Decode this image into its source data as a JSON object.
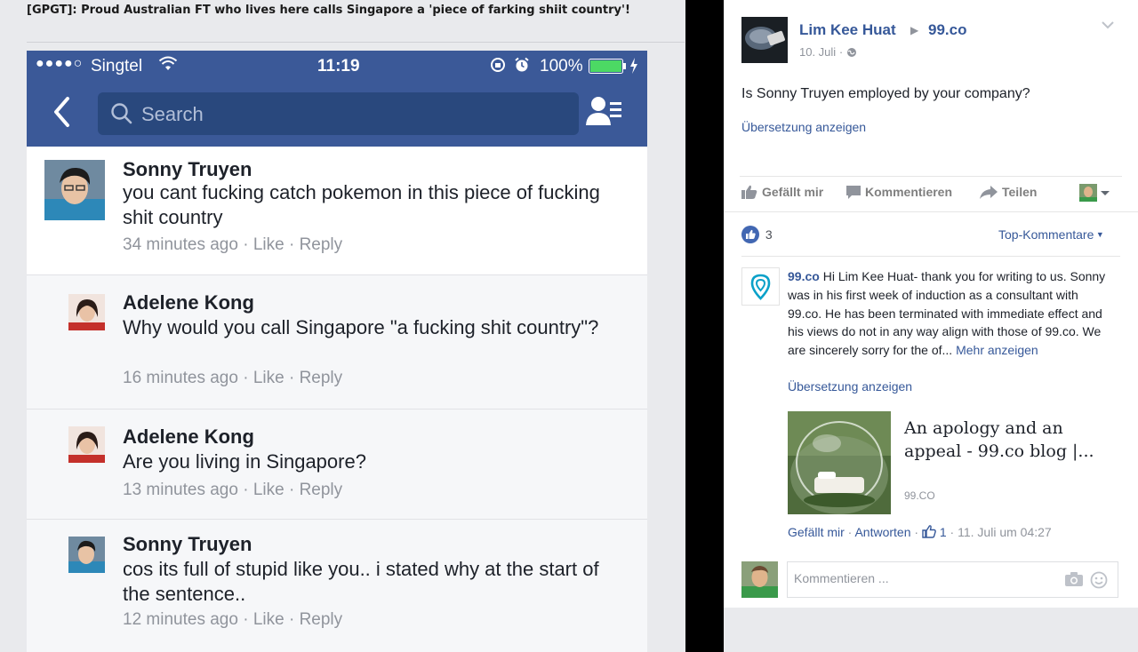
{
  "forum_post": {
    "title": "[GPGT]: Proud Australian FT who lives here calls Singapore a 'piece of farking shiit country'!"
  },
  "phone": {
    "status": {
      "signal": "●●●●○",
      "carrier": "Singtel",
      "time": "11:19",
      "battery": "100%"
    },
    "search": {
      "placeholder": "Search"
    },
    "comments": [
      {
        "name": "Sonny Truyen",
        "text": "you cant fucking catch pokemon in this piece of fucking shit country",
        "time": "34 minutes ago",
        "like": "Like",
        "reply": "Reply"
      },
      {
        "name": "Adelene Kong",
        "text": "Why would you call Singapore \"a fucking shit country\"?",
        "time": "16 minutes ago",
        "like": "Like",
        "reply": "Reply"
      },
      {
        "name": "Adelene Kong",
        "text": "Are you living in Singapore?",
        "time": "13 minutes ago",
        "like": "Like",
        "reply": "Reply"
      },
      {
        "name": "Sonny Truyen",
        "text": "cos its full of stupid like you.. i stated why at the start of the sentence..",
        "time": "12 minutes ago",
        "like": "Like",
        "reply": "Reply"
      }
    ]
  },
  "fb_post": {
    "author": "Lim Kee Huat",
    "target_page": "99.co",
    "date": "10. Juli",
    "question": "Is Sonny Truyen employed by your company?",
    "translate": "Übersetzung anzeigen",
    "actions": {
      "like": "Gefällt mir",
      "comment": "Kommentieren",
      "share": "Teilen"
    },
    "like_count": "3",
    "sort": "Top-Kommentare",
    "reply": {
      "author": "99.co",
      "text": "Hi Lim Kee Huat- thank you for writing to us. Sonny was in his first week of induction as a consultant with 99.co. He has been terminated with immediate effect and his views do not in any way align with those of 99.co. We are sincerely sorry for the of...",
      "more": "Mehr anzeigen",
      "translate": "Übersetzung anzeigen",
      "link_title": "An apology and an appeal - 99.co blog |...",
      "link_domain": "99.CO",
      "like_action": "Gefällt mir",
      "reply_action": "Antworten",
      "like_count": "1",
      "timestamp": "11. Juli um 04:27"
    },
    "comment_placeholder": "Kommentieren ..."
  },
  "colors": {
    "fb_blue": "#3b5998",
    "link_blue": "#365899",
    "battery_green": "#4cd964",
    "brand_99co": "#0aa1c9"
  }
}
